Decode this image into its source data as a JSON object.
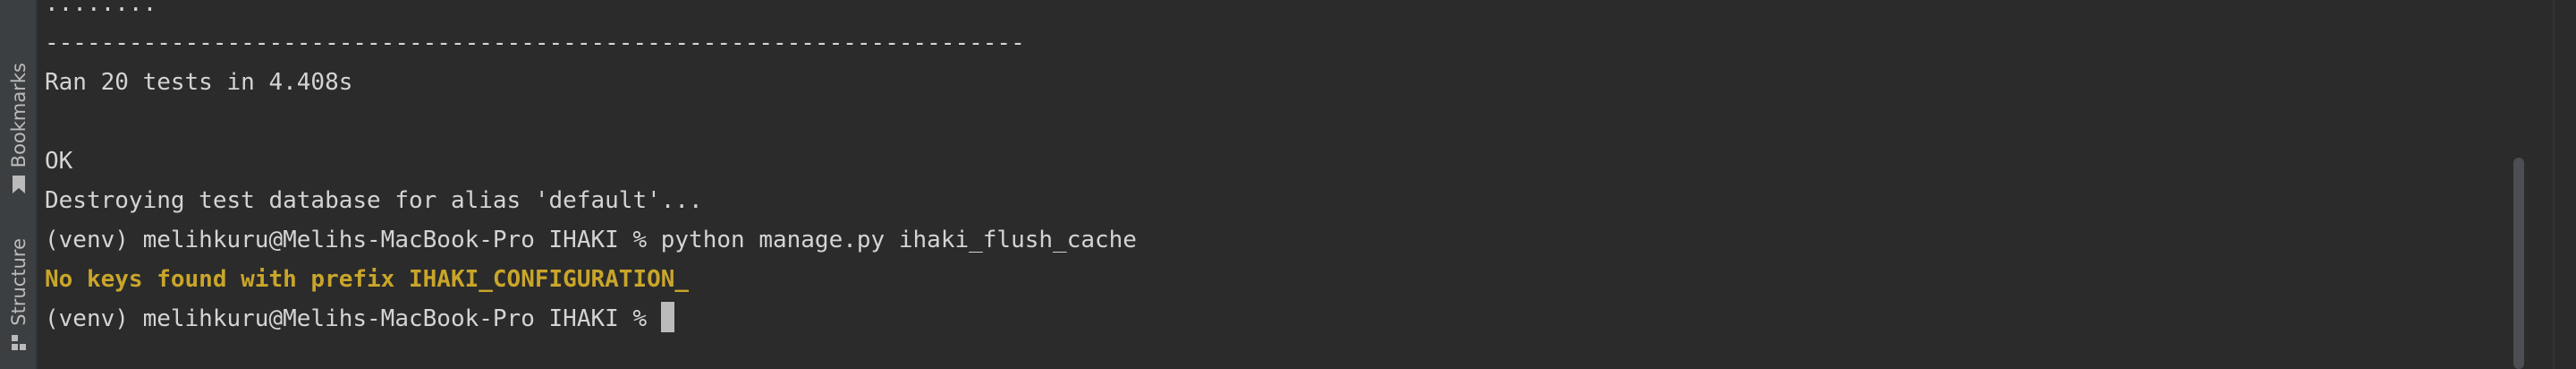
{
  "sidebar": {
    "tabs": [
      {
        "label": "Bookmarks",
        "icon": "bookmark-icon"
      },
      {
        "label": "Structure",
        "icon": "structure-icon"
      }
    ]
  },
  "terminal": {
    "lines": [
      {
        "text": "........",
        "kind": "output"
      },
      {
        "text": "----------------------------------------------------------------------",
        "kind": "output"
      },
      {
        "text": "Ran 20 tests in 4.408s",
        "kind": "output"
      },
      {
        "text": "",
        "kind": "output"
      },
      {
        "text": "OK",
        "kind": "output"
      },
      {
        "text": "Destroying test database for alias 'default'...",
        "kind": "output"
      },
      {
        "text": "(venv) melihkuru@Melihs-MacBook-Pro IHAKI % python manage.py ihaki_flush_cache",
        "kind": "command"
      },
      {
        "text": "No keys found with prefix IHAKI_CONFIGURATION_",
        "kind": "warning"
      }
    ],
    "prompt": "(venv) melihkuru@Melihs-MacBook-Pro IHAKI % ",
    "warning_color": "#c9a52a",
    "text_color": "#d4d4d4",
    "background": "#2b2b2b"
  }
}
